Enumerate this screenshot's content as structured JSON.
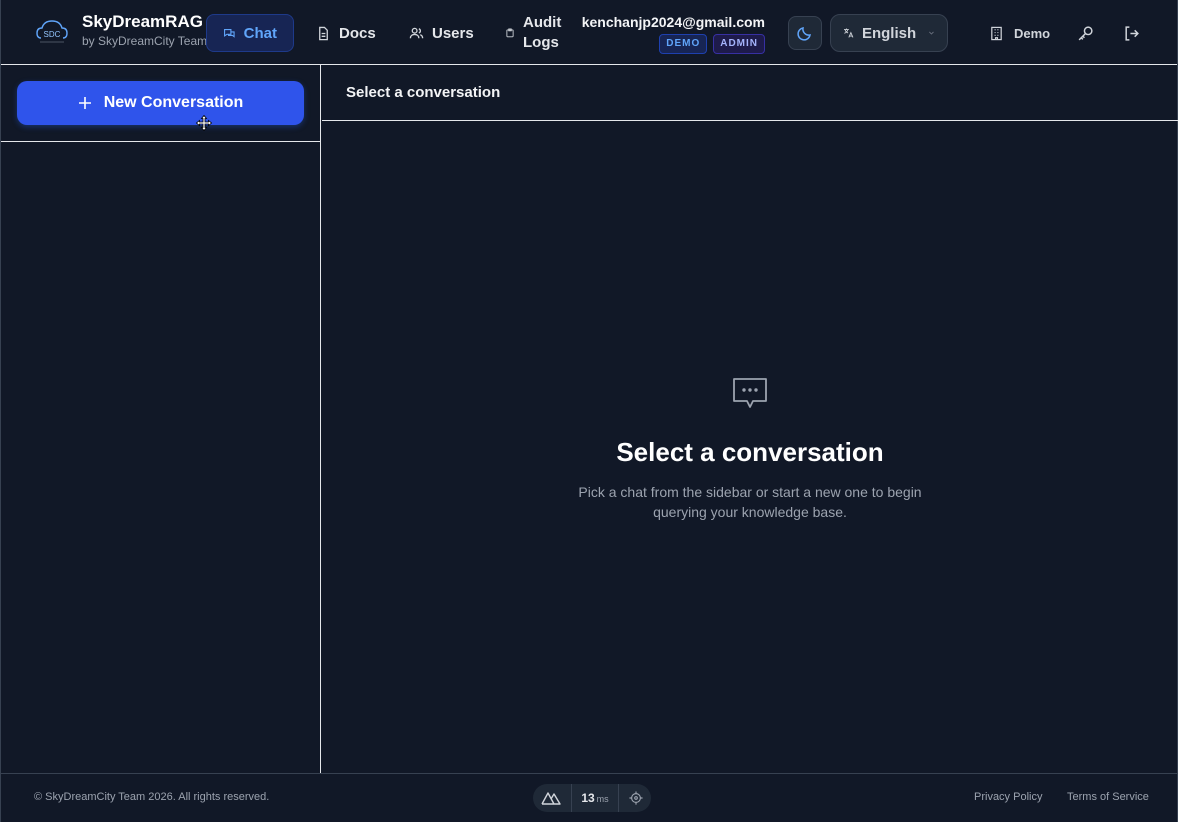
{
  "brand": {
    "name": "SkyDreamRAG",
    "subtitle": "by SkyDreamCity Team",
    "logo_text": "SDC"
  },
  "nav": {
    "chat": "Chat",
    "docs": "Docs",
    "users": "Users",
    "audit_logs": "Audit Logs"
  },
  "user": {
    "email": "kenchanjp2024@gmail.com",
    "badges": [
      "DEMO",
      "ADMIN"
    ]
  },
  "language": {
    "selected": "English"
  },
  "tenant": {
    "label": "Demo"
  },
  "sidebar": {
    "new_conversation": "New Conversation"
  },
  "main": {
    "header_title": "Select a conversation",
    "empty_title": "Select a conversation",
    "empty_description": "Pick a chat from the sidebar or start a new one to begin querying your knowledge base."
  },
  "footer": {
    "copyright": "© SkyDreamCity Team 2026. All rights reserved.",
    "perf_value": "13",
    "perf_unit": "ms",
    "privacy": "Privacy Policy",
    "terms": "Terms of Service"
  },
  "colors": {
    "background": "#111827",
    "accent": "#2f54eb",
    "active_nav_bg": "#172554",
    "active_nav_text": "#60a5fa"
  },
  "icons": {
    "chat": "chat-bubbles-icon",
    "docs": "document-icon",
    "users": "users-icon",
    "audit": "clipboard-icon",
    "theme": "moon-icon",
    "language": "translate-icon",
    "chevron": "chevron-down-icon",
    "tenant": "building-icon",
    "key": "key-icon",
    "logout": "logout-icon",
    "plus": "plus-icon",
    "empty": "chat-dots-icon",
    "nuxt": "nuxt-logo-icon",
    "target": "crosshair-icon"
  }
}
